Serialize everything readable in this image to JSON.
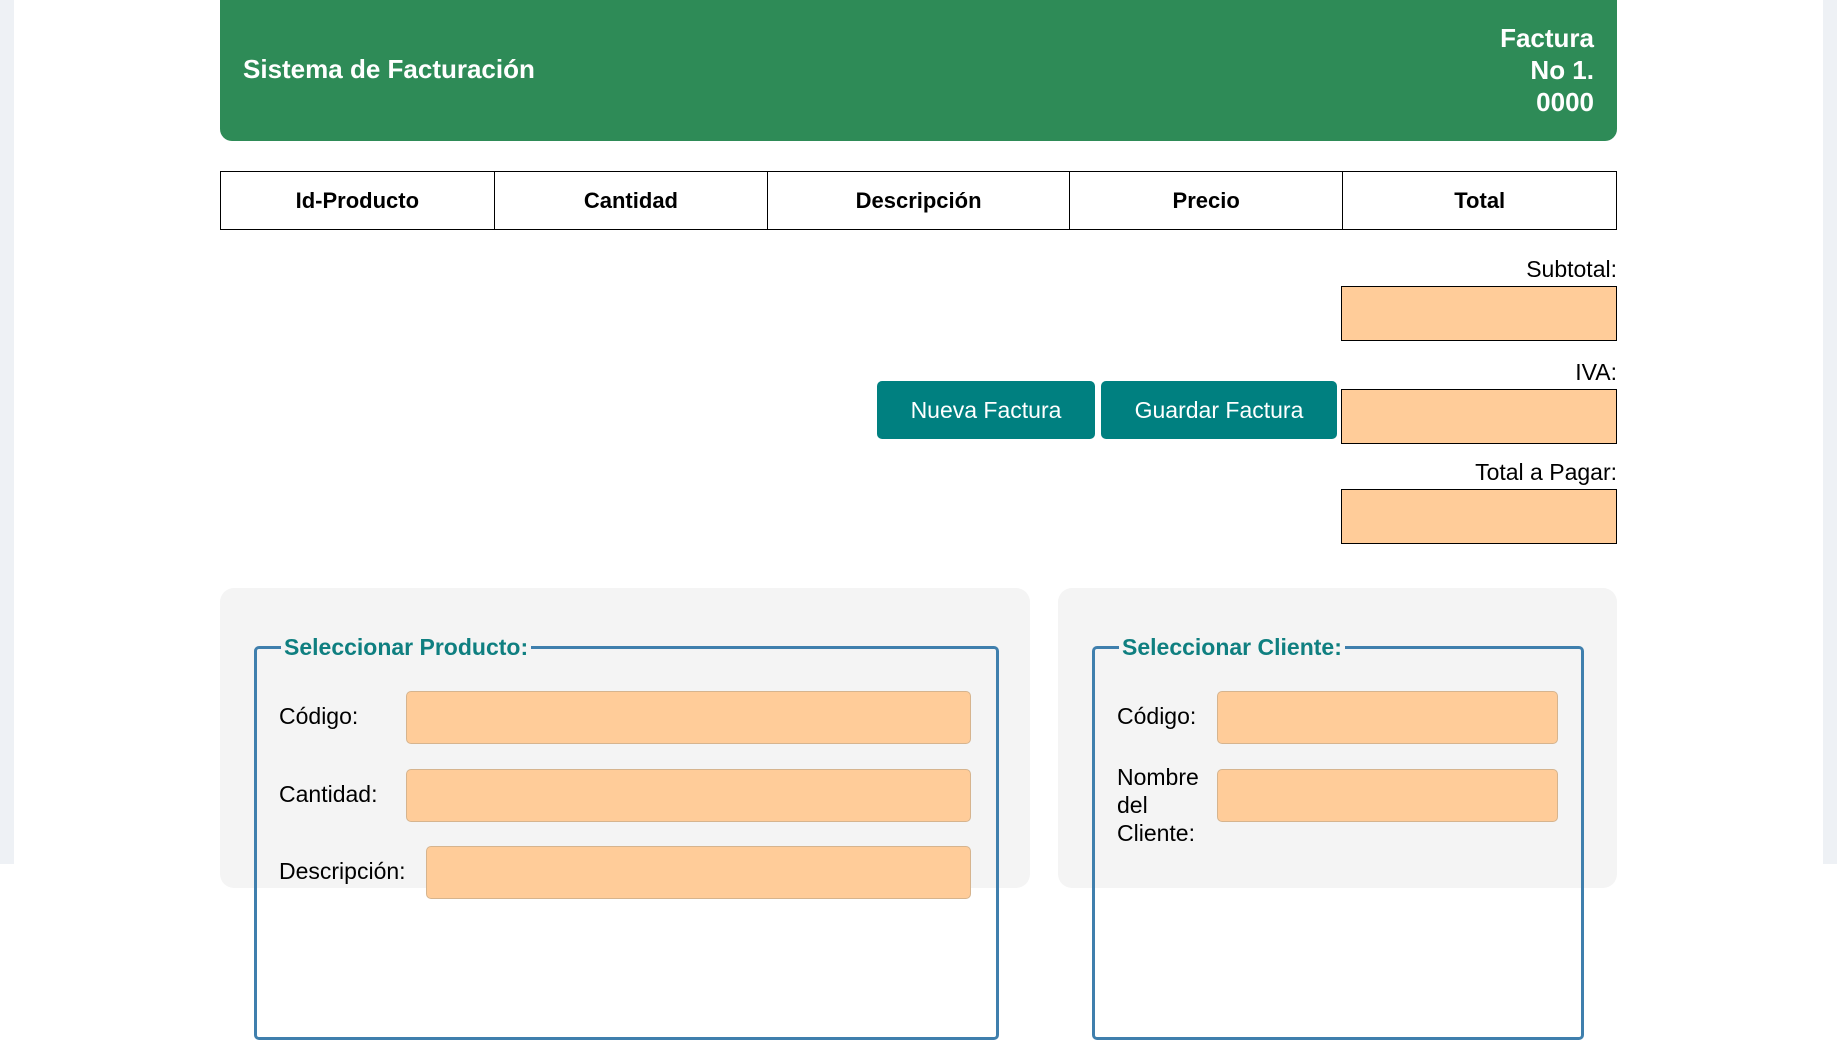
{
  "header": {
    "title": "Sistema de Facturación",
    "invoice_line1": "Factura",
    "invoice_line2": "No 1.",
    "invoice_line3": "0000"
  },
  "table": {
    "columns": [
      "Id-Producto",
      "Cantidad",
      "Descripción",
      "Precio",
      "Total"
    ]
  },
  "totals": {
    "subtotal_label": "Subtotal:",
    "iva_label": "IVA:",
    "total_label": "Total a Pagar:"
  },
  "actions": {
    "new_label": "Nueva Factura",
    "save_label": "Guardar Factura"
  },
  "product_panel": {
    "legend": "Seleccionar Producto:",
    "code_label": "Código:",
    "quantity_label": "Cantidad:",
    "description_label": "Descripción:"
  },
  "client_panel": {
    "legend": "Seleccionar Cliente:",
    "code_label": "Código:",
    "name_label_line1": "Nombre",
    "name_label_line2": "del",
    "name_label_line3": "Cliente:"
  },
  "colors": {
    "header_bg": "#2e8b57",
    "button_bg": "#008080",
    "field_bg": "#ffcc99",
    "legend_color": "#0f7f80",
    "fieldset_border": "#3f7fad"
  }
}
